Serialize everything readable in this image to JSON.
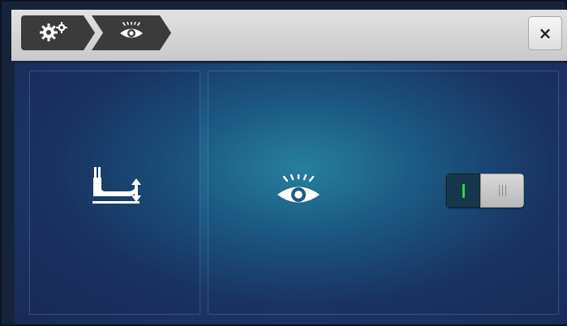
{
  "header": {
    "breadcrumbs": [
      {
        "icon": "settings-gears-icon"
      },
      {
        "icon": "eye-icon"
      }
    ],
    "close_label": "×"
  },
  "panels": {
    "left": {
      "icon": "presser-foot-lift-icon"
    },
    "right": {
      "icon": "eye-icon",
      "toggle": {
        "state": "on",
        "on_color": "#29d848"
      }
    }
  },
  "colors": {
    "header_bg": "#d6d6d6",
    "crumb_bg": "#3b3b3b",
    "content_center": "#2a8aa6",
    "content_edge": "#1a2956"
  }
}
